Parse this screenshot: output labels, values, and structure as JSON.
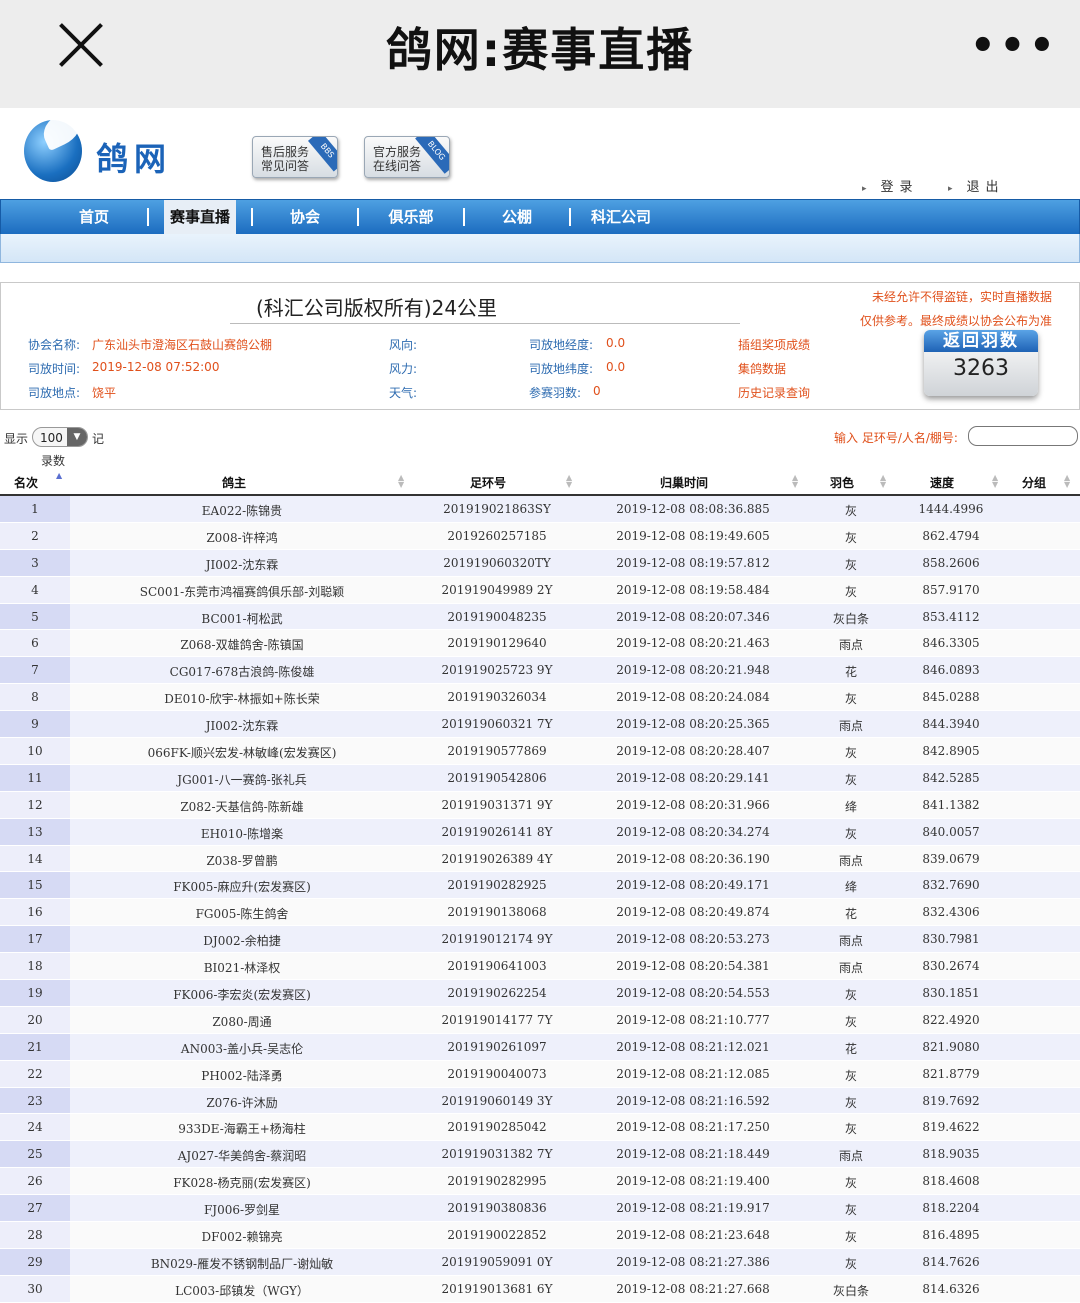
{
  "wechat": {
    "title": "鸽网:赛事直播"
  },
  "site": {
    "logo_text": "鸽网",
    "svc1": {
      "line1": "售后服务",
      "line2": "常见问答",
      "tag": "BBS"
    },
    "svc2": {
      "line1": "官方服务",
      "line2": "在线问答",
      "tag": "BLOG"
    },
    "login": "登录",
    "logout": "退出"
  },
  "nav": [
    {
      "label": "首页"
    },
    {
      "label": "赛事直播"
    },
    {
      "label": "协会"
    },
    {
      "label": "俱乐部"
    },
    {
      "label": "公棚"
    },
    {
      "label": "科汇公司"
    }
  ],
  "race": {
    "title": "(科汇公司版权所有)24公里",
    "notice1": "未经允许不得盗链，实时直播数据",
    "notice2": "仅供参考。最终成绩以协会公布为准",
    "assoc_label": "协会名称:",
    "assoc_value": "广东汕头市澄海区石鼓山赛鸽公棚",
    "release_time_label": "司放时间:",
    "release_time_value": "2019-12-08 07:52:00",
    "release_place_label": "司放地点:",
    "release_place_value": "饶平",
    "wind_dir_label": "风向:",
    "wind_force_label": "风力:",
    "weather_label": "天气:",
    "lng_label": "司放地经度:",
    "lng_value": "0.0",
    "lat_label": "司放地纬度:",
    "lat_value": "0.0",
    "count_label": "参赛羽数:",
    "count_value": "0",
    "link1": "插组奖项成绩",
    "link2": "集鸽数据",
    "link3": "历史记录查询",
    "return_label": "返回羽数",
    "return_count": "3263"
  },
  "controls": {
    "show_label": "显示",
    "page_size": "100",
    "rec_label": "记",
    "rec_label2": "录数",
    "search_label": "输入 足环号/人名/棚号:"
  },
  "table": {
    "headers": [
      "名次",
      "鸽主",
      "足环号",
      "归巢时间",
      "羽色",
      "速度",
      "分组"
    ],
    "rows": [
      [
        "1",
        "EA022-陈锦贵",
        "201919021863SY",
        "2019-12-08 08:08:36.885",
        "灰",
        "1444.4996"
      ],
      [
        "2",
        "Z008-许梓鸿",
        "2019260257185",
        "2019-12-08 08:19:49.605",
        "灰",
        "862.4794"
      ],
      [
        "3",
        "JI002-沈东霖",
        "201919060320TY",
        "2019-12-08 08:19:57.812",
        "灰",
        "858.2606"
      ],
      [
        "4",
        "SC001-东莞市鸿福赛鸽俱乐部-刘聪颖",
        "201919049989 2Y",
        "2019-12-08 08:19:58.484",
        "灰",
        "857.9170"
      ],
      [
        "5",
        "BC001-柯松武",
        "2019190048235",
        "2019-12-08 08:20:07.346",
        "灰白条",
        "853.4112"
      ],
      [
        "6",
        "Z068-双雄鸽舍-陈镇国",
        "2019190129640",
        "2019-12-08 08:20:21.463",
        "雨点",
        "846.3305"
      ],
      [
        "7",
        "CG017-678古浪鸽-陈俊雄",
        "201919025723 9Y",
        "2019-12-08 08:20:21.948",
        "花",
        "846.0893"
      ],
      [
        "8",
        "DE010-欣宇-林振如+陈长荣",
        "2019190326034",
        "2019-12-08 08:20:24.084",
        "灰",
        "845.0288"
      ],
      [
        "9",
        "JI002-沈东霖",
        "201919060321 7Y",
        "2019-12-08 08:20:25.365",
        "雨点",
        "844.3940"
      ],
      [
        "10",
        "066FK-顺兴宏发-林敏峰(宏发赛区)",
        "2019190577869",
        "2019-12-08 08:20:28.407",
        "灰",
        "842.8905"
      ],
      [
        "11",
        "JG001-八一赛鸽-张礼兵",
        "2019190542806",
        "2019-12-08 08:20:29.141",
        "灰",
        "842.5285"
      ],
      [
        "12",
        "Z082-天基信鸽-陈新雄",
        "201919031371 9Y",
        "2019-12-08 08:20:31.966",
        "绛",
        "841.1382"
      ],
      [
        "13",
        "EH010-陈增楽",
        "201919026141 8Y",
        "2019-12-08 08:20:34.274",
        "灰",
        "840.0057"
      ],
      [
        "14",
        "Z038-罗曾鹏",
        "201919026389 4Y",
        "2019-12-08 08:20:36.190",
        "雨点",
        "839.0679"
      ],
      [
        "15",
        "FK005-麻应升(宏发赛区)",
        "2019190282925",
        "2019-12-08 08:20:49.171",
        "绛",
        "832.7690"
      ],
      [
        "16",
        "FG005-陈生鸽舍",
        "2019190138068",
        "2019-12-08 08:20:49.874",
        "花",
        "832.4306"
      ],
      [
        "17",
        "DJ002-余柏捷",
        "201919012174 9Y",
        "2019-12-08 08:20:53.273",
        "雨点",
        "830.7981"
      ],
      [
        "18",
        "BI021-林泽权",
        "2019190641003",
        "2019-12-08 08:20:54.381",
        "雨点",
        "830.2674"
      ],
      [
        "19",
        "FK006-李宏炎(宏发赛区)",
        "2019190262254",
        "2019-12-08 08:20:54.553",
        "灰",
        "830.1851"
      ],
      [
        "20",
        "Z080-周通",
        "201919014177 7Y",
        "2019-12-08 08:21:10.777",
        "灰",
        "822.4920"
      ],
      [
        "21",
        "AN003-盖小兵-吴志伦",
        "2019190261097",
        "2019-12-08 08:21:12.021",
        "花",
        "821.9080"
      ],
      [
        "22",
        "PH002-陆泽勇",
        "2019190040073",
        "2019-12-08 08:21:12.085",
        "灰",
        "821.8779"
      ],
      [
        "23",
        "Z076-许沐励",
        "201919060149 3Y",
        "2019-12-08 08:21:16.592",
        "灰",
        "819.7692"
      ],
      [
        "24",
        "933DE-海霸王+杨海柱",
        "2019190285042",
        "2019-12-08 08:21:17.250",
        "灰",
        "819.4622"
      ],
      [
        "25",
        "AJ027-华美鸽舍-蔡润昭",
        "201919031382 7Y",
        "2019-12-08 08:21:18.449",
        "雨点",
        "818.9035"
      ],
      [
        "26",
        "FK028-杨克丽(宏发赛区)",
        "2019190282995",
        "2019-12-08 08:21:19.400",
        "灰",
        "818.4608"
      ],
      [
        "27",
        "FJ006-罗剑星",
        "2019190380836",
        "2019-12-08 08:21:19.917",
        "灰",
        "818.2204"
      ],
      [
        "28",
        "DF002-赖锦亮",
        "2019190022852",
        "2019-12-08 08:21:23.648",
        "灰",
        "816.4895"
      ],
      [
        "29",
        "BN029-雁发不锈钢制品厂-谢灿敏",
        "201919059091 0Y",
        "2019-12-08 08:21:27.386",
        "灰",
        "814.7626"
      ],
      [
        "30",
        "LC003-邱镇发（WGY）",
        "201919013681 6Y",
        "2019-12-08 08:21:27.668",
        "灰白条",
        "814.6326"
      ]
    ]
  }
}
